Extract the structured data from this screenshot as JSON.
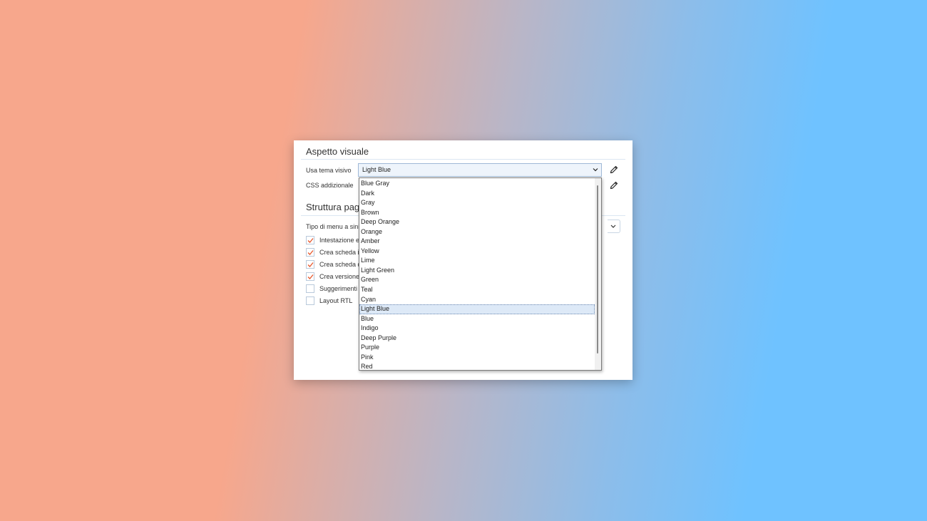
{
  "sections": {
    "visual": {
      "title": "Aspetto visuale"
    },
    "structure": {
      "title": "Struttura pagi"
    }
  },
  "theme": {
    "label": "Usa tema visivo",
    "selected": "Light Blue",
    "options": [
      "Blue Gray",
      "Dark",
      "Gray",
      "Brown",
      "Deep Orange",
      "Orange",
      "Amber",
      "Yellow",
      "Lime",
      "Light Green",
      "Green",
      "Teal",
      "Cyan",
      "Light Blue",
      "Blue",
      "Indigo",
      "Deep Purple",
      "Purple",
      "Pink",
      "Red"
    ],
    "selected_index": 13
  },
  "css": {
    "label": "CSS addizionale"
  },
  "menu_type": {
    "label": "Tipo di menu a sinis"
  },
  "checkboxes": [
    {
      "label": "Intestazione e",
      "checked": true
    },
    {
      "label": "Crea scheda ir",
      "checked": true
    },
    {
      "label": "Crea scheda d",
      "checked": true
    },
    {
      "label": "Crea versione",
      "checked": true
    },
    {
      "label": "Suggerimenti",
      "checked": false
    },
    {
      "label": "Layout RTL",
      "checked": false
    }
  ],
  "icons": {
    "edit": "pencil-icon",
    "dropdown": "chevron-down-icon",
    "check": "checkmark-icon"
  },
  "colors": {
    "check_accent": "#e8562a",
    "selected_option_bg": "#dde9f7",
    "select_bg": "#eef4fb"
  }
}
